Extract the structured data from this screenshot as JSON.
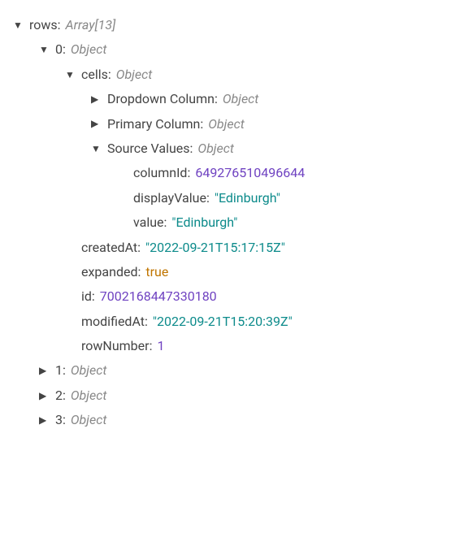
{
  "tree": {
    "rows_key": "rows",
    "rows_type": "Array[13]",
    "row0_key": "0",
    "row0_type": "Object",
    "cells_key": "cells",
    "cells_type": "Object",
    "dropdown_key": "Dropdown Column",
    "dropdown_type": "Object",
    "primary_key": "Primary Column",
    "primary_type": "Object",
    "source_key": "Source Values",
    "source_type": "Object",
    "columnId_key": "columnId",
    "columnId_val": "649276510496644",
    "displayValue_key": "displayValue",
    "displayValue_val": "\"Edinburgh\"",
    "value_key": "value",
    "value_val": "\"Edinburgh\"",
    "createdAt_key": "createdAt",
    "createdAt_val": "\"2022-09-21T15:17:15Z\"",
    "expanded_key": "expanded",
    "expanded_val": "true",
    "id_key": "id",
    "id_val": "7002168447330180",
    "modifiedAt_key": "modifiedAt",
    "modifiedAt_val": "\"2022-09-21T15:20:39Z\"",
    "rowNumber_key": "rowNumber",
    "rowNumber_val": "1",
    "row1_key": "1",
    "row1_type": "Object",
    "row2_key": "2",
    "row2_type": "Object",
    "row3_key": "3",
    "row3_type": "Object"
  }
}
